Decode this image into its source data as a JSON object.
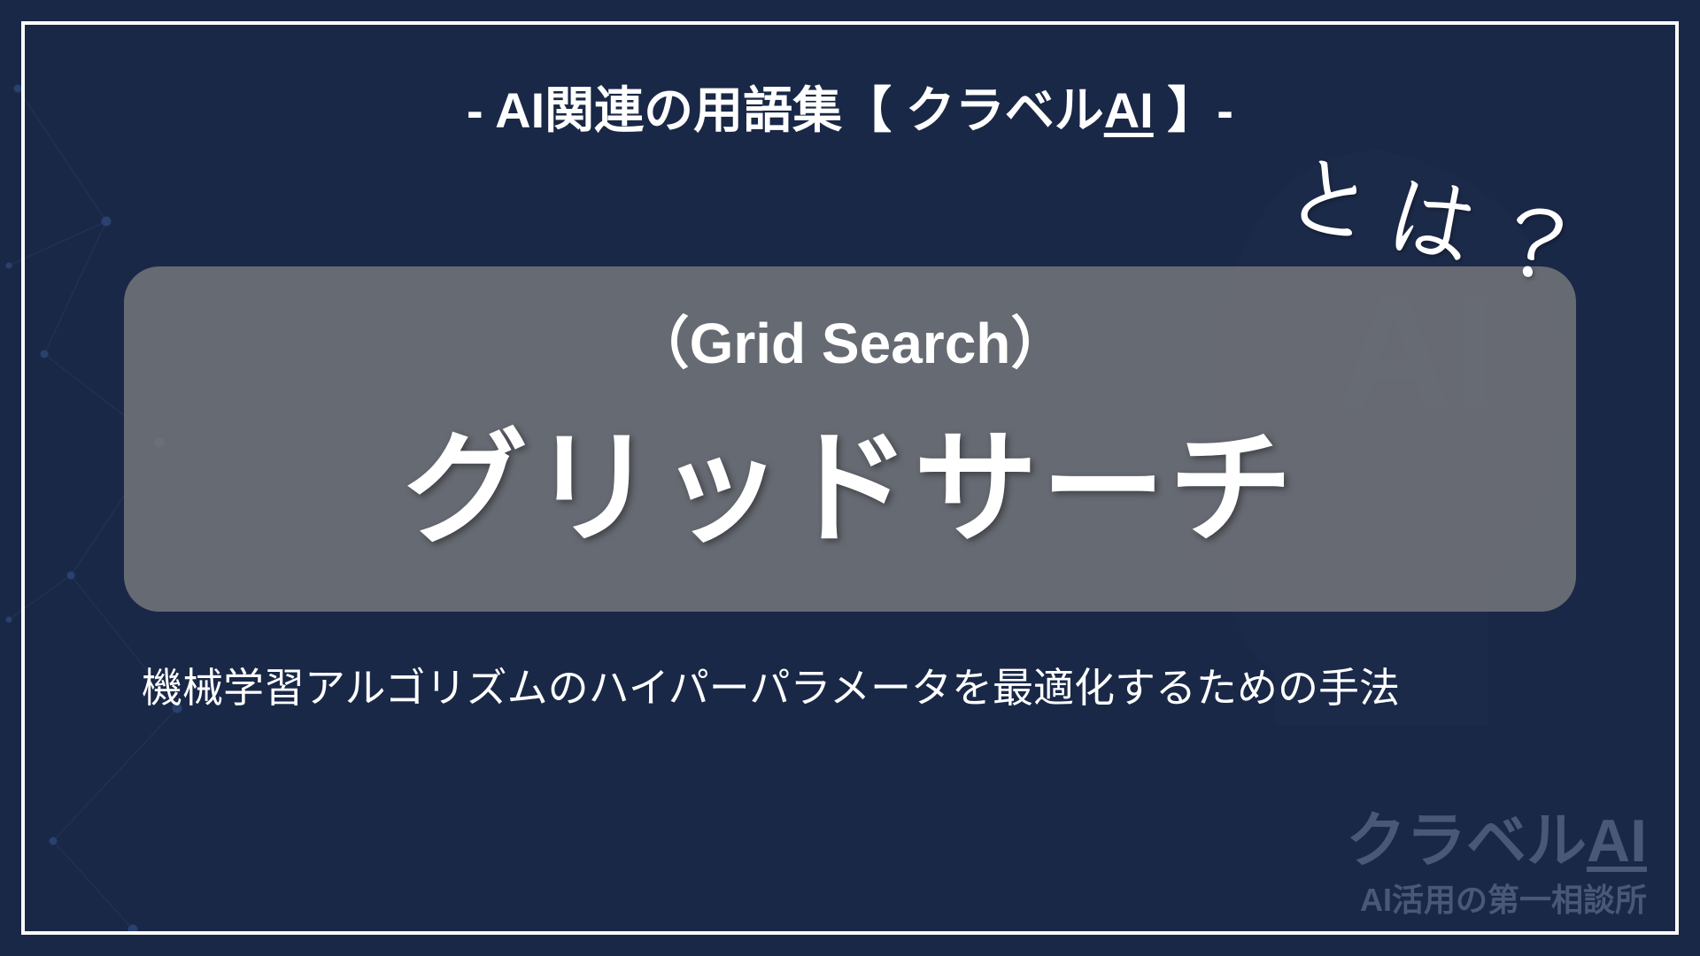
{
  "header": {
    "prefix": "- AI関連の用語集【 クラベル",
    "ai_text": "AI",
    "suffix": " 】-"
  },
  "term": {
    "english": "（Grid Search）",
    "japanese": "グリッドサーチ",
    "what_is": "とは？"
  },
  "description": "機械学習アルゴリズムのハイパーパラメータを最適化するための手法",
  "branding": {
    "name_prefix": "クラベル",
    "name_ai": "AI",
    "tagline": "AI活用の第一相談所"
  }
}
